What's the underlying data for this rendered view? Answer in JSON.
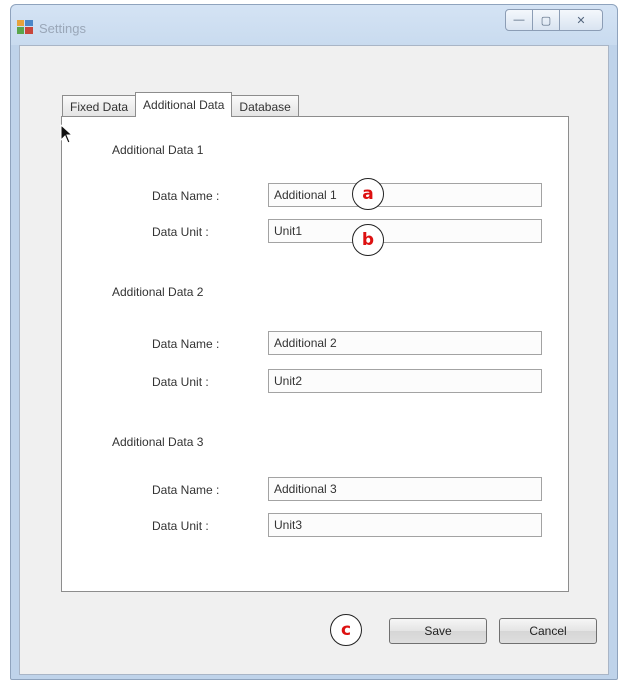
{
  "window": {
    "title": "Settings",
    "buttons": {
      "minimize": "—",
      "maximize": "▢",
      "close": "✕"
    }
  },
  "tabs": [
    {
      "label": "Fixed Data",
      "active": false
    },
    {
      "label": "Additional Data",
      "active": true
    },
    {
      "label": "Database",
      "active": false
    }
  ],
  "groups": [
    {
      "title": "Additional Data 1",
      "name_label": "Data Name :",
      "name_value": "Additional 1",
      "unit_label": "Data Unit :",
      "unit_value": "Unit1"
    },
    {
      "title": "Additional Data 2",
      "name_label": "Data Name :",
      "name_value": "Additional 2",
      "unit_label": "Data Unit :",
      "unit_value": "Unit2"
    },
    {
      "title": "Additional Data 3",
      "name_label": "Data Name :",
      "name_value": "Additional 3",
      "unit_label": "Data Unit :",
      "unit_value": "Unit3"
    }
  ],
  "actions": {
    "save_label": "Save",
    "cancel_label": "Cancel"
  },
  "annotations": {
    "a": "a",
    "b": "b",
    "c": "c"
  },
  "colors": {
    "marker_text": "#dd1111",
    "title_text": "#9aa7b8"
  }
}
